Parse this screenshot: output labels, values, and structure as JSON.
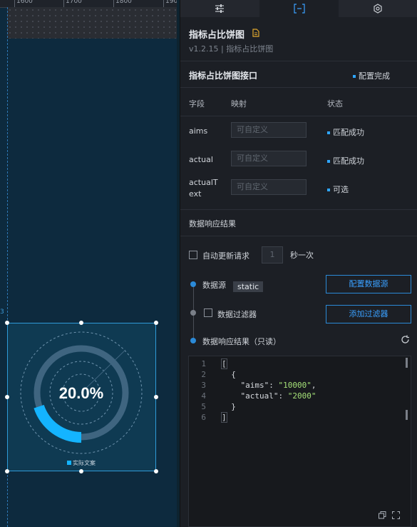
{
  "ruler": {
    "ticks": [
      "1600",
      "1700",
      "1800",
      "190"
    ]
  },
  "canvas": {
    "corner_number": "3"
  },
  "widget": {
    "center_value": "20.0%",
    "legend_label": "实际文案",
    "progress_fraction": 0.2,
    "accent_color": "#14b4ff"
  },
  "tabs": [
    {
      "name": "tab-settings",
      "icon": "sliders-icon",
      "active": false
    },
    {
      "name": "tab-data",
      "icon": "data-bracket-icon",
      "active": true
    },
    {
      "name": "tab-interaction",
      "icon": "interaction-icon",
      "active": false
    }
  ],
  "header": {
    "title": "指标占比饼图",
    "version_line": "v1.2.15 | 指标占比饼图"
  },
  "interface": {
    "title": "指标占比饼图接口",
    "status": "配置完成"
  },
  "mapping": {
    "col_field": "字段",
    "col_map": "映射",
    "col_status": "状态",
    "rows": [
      {
        "field": "aims",
        "placeholder": "可自定义",
        "status": "匹配成功"
      },
      {
        "field": "actual",
        "placeholder": "可自定义",
        "status": "匹配成功"
      },
      {
        "field": "actualT",
        "field2": "ext",
        "placeholder": "可自定义",
        "status": "可选"
      }
    ]
  },
  "response": {
    "title": "数据响应结果"
  },
  "auto_update": {
    "label": "自动更新请求",
    "seconds": "1",
    "unit": "秒一次"
  },
  "steps": {
    "source_label": "数据源",
    "source_type": "static",
    "config_button": "配置数据源",
    "filter_label": "数据过滤器",
    "add_filter_button": "添加过滤器",
    "result_label": "数据响应结果（只读）"
  },
  "code": {
    "line_numbers": [
      "1",
      "2",
      "3",
      "4",
      "5",
      "6"
    ],
    "open_bracket": "[",
    "open_brace": "  {",
    "key_aims": "    \"aims\": ",
    "val_aims": "\"10000\"",
    "comma": ",",
    "key_actual": "    \"actual\": ",
    "val_actual": "\"2000\"",
    "close_brace": "  }",
    "close_bracket": "]"
  }
}
